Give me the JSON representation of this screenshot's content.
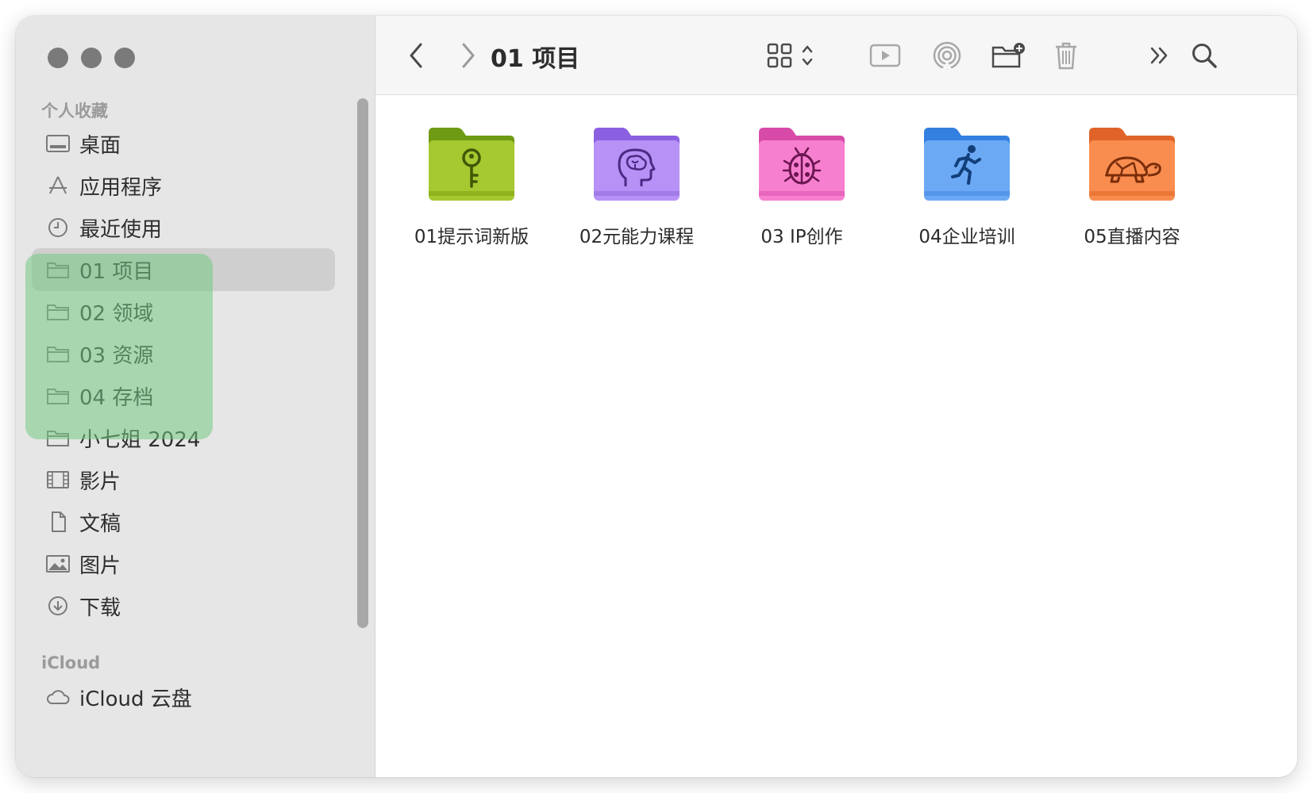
{
  "window": {
    "title": "01 项目"
  },
  "sidebar": {
    "favorites_title": "个人收藏",
    "favorites": [
      {
        "label": "桌面",
        "icon": "desktop-icon"
      },
      {
        "label": "应用程序",
        "icon": "applications-icon"
      },
      {
        "label": "最近使用",
        "icon": "clock-icon"
      },
      {
        "label": "01 项目",
        "icon": "folder-icon",
        "selected": true
      },
      {
        "label": "02 领域",
        "icon": "folder-icon"
      },
      {
        "label": "03 资源",
        "icon": "folder-icon"
      },
      {
        "label": "04 存档",
        "icon": "folder-icon"
      },
      {
        "label": "小七姐 2024",
        "icon": "folder-icon"
      },
      {
        "label": "影片",
        "icon": "film-icon"
      },
      {
        "label": "文稿",
        "icon": "document-icon"
      },
      {
        "label": "图片",
        "icon": "photo-icon"
      },
      {
        "label": "下载",
        "icon": "download-icon"
      }
    ],
    "icloud_title": "iCloud",
    "icloud": [
      {
        "label": "iCloud 云盘",
        "icon": "cloud-icon"
      }
    ]
  },
  "toolbar": {
    "back": "chevron-left-icon",
    "forward": "chevron-right-icon",
    "view": "grid-view-icon",
    "actions": [
      "play-icon",
      "airdrop-icon",
      "new-folder-icon",
      "trash-icon",
      "more-icon",
      "search-icon"
    ]
  },
  "folders": [
    {
      "label": "01提示词新版",
      "color": "#8fbf1f",
      "icon": "key-icon"
    },
    {
      "label": "02元能力课程",
      "color": "#a77df2",
      "icon": "brain-icon"
    },
    {
      "label": "03 IP创作",
      "color": "#f06fc5",
      "icon": "ladybug-icon"
    },
    {
      "label": "04企业培训",
      "color": "#5a9ff0",
      "icon": "runner-icon"
    },
    {
      "label": "05直播内容",
      "color": "#f4803f",
      "icon": "turtle-icon"
    }
  ],
  "colors": {
    "sidebar_bg": "#e6e6e6",
    "selection": "#cfcfcf",
    "highlight_overlay": "#73c882"
  }
}
